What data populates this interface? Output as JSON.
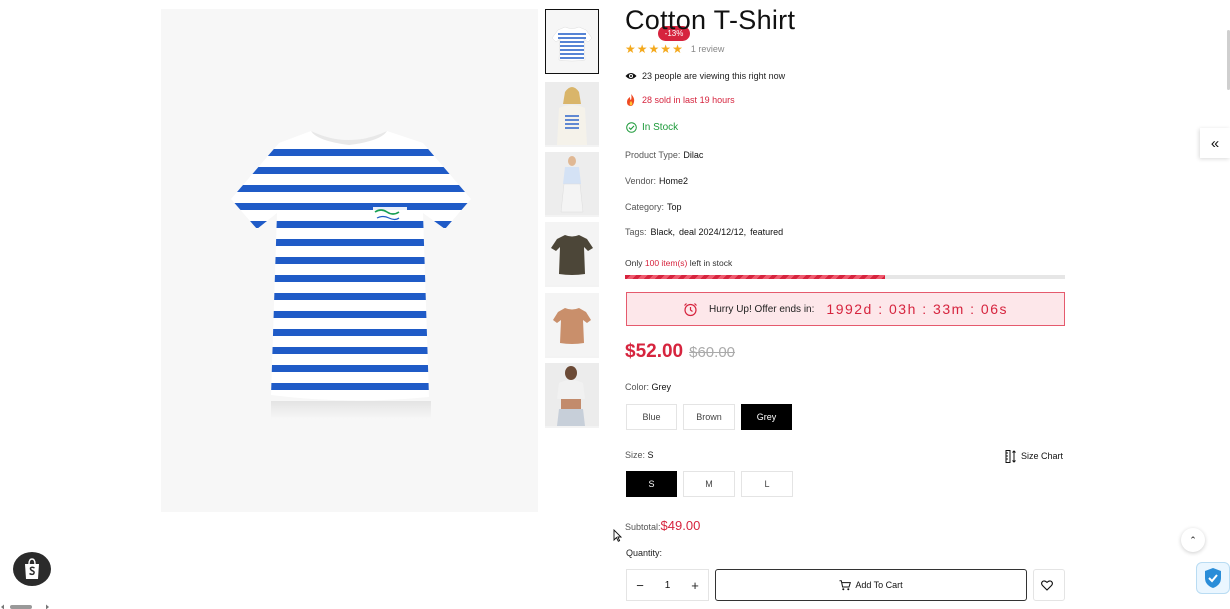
{
  "product": {
    "title": "Cotton T-Shirt",
    "discount_badge": "-13%",
    "rating_stars": 5,
    "review_text": "1 review",
    "viewing": {
      "count": "23",
      "text": "people are viewing this right now"
    },
    "sold": {
      "count": "28",
      "text_mid": "sold in last",
      "hours": "19",
      "text_end": "hours"
    },
    "stock_status": "In Stock",
    "meta": {
      "product_type_label": "Product Type:",
      "product_type": "Dilac",
      "vendor_label": "Vendor:",
      "vendor": "Home2",
      "category_label": "Category:",
      "category": "Top",
      "tags_label": "Tags:",
      "tags": [
        "Black,",
        "deal 2024/12/12,",
        "featured"
      ]
    },
    "stock_left": {
      "prefix": "Only",
      "count": "100 item(s)",
      "suffix": "left in stock",
      "fraction": 0.59
    },
    "countdown": {
      "label": "Hurry Up! Offer ends in:",
      "time": "1992d : 03h : 33m : 06s"
    },
    "price": {
      "current": "$52.00",
      "compare": "$60.00"
    },
    "color": {
      "label": "Color:",
      "selected": "Grey",
      "options": [
        "Blue",
        "Brown",
        "Grey"
      ]
    },
    "size": {
      "label": "Size:",
      "selected": "S",
      "options": [
        "S",
        "M",
        "L"
      ],
      "chart_label": "Size Chart"
    },
    "subtotal": {
      "label": "Subtotal:",
      "amount": "$49.00"
    },
    "quantity": {
      "label": "Quantity:",
      "value": "1",
      "minus": "−",
      "plus": "+"
    },
    "add_to_cart": "Add To Cart"
  },
  "thumbnails": [
    "striped-tee",
    "model-striped-tee",
    "model-full-body",
    "brown-tee",
    "tan-tee",
    "model-cropped-tee"
  ],
  "widgets": {
    "side_toggle": "«",
    "back_to_top": "⌃"
  },
  "colors": {
    "accent": "#d6243e",
    "in_stock": "#1d9a3a",
    "star": "#f4a91d"
  }
}
